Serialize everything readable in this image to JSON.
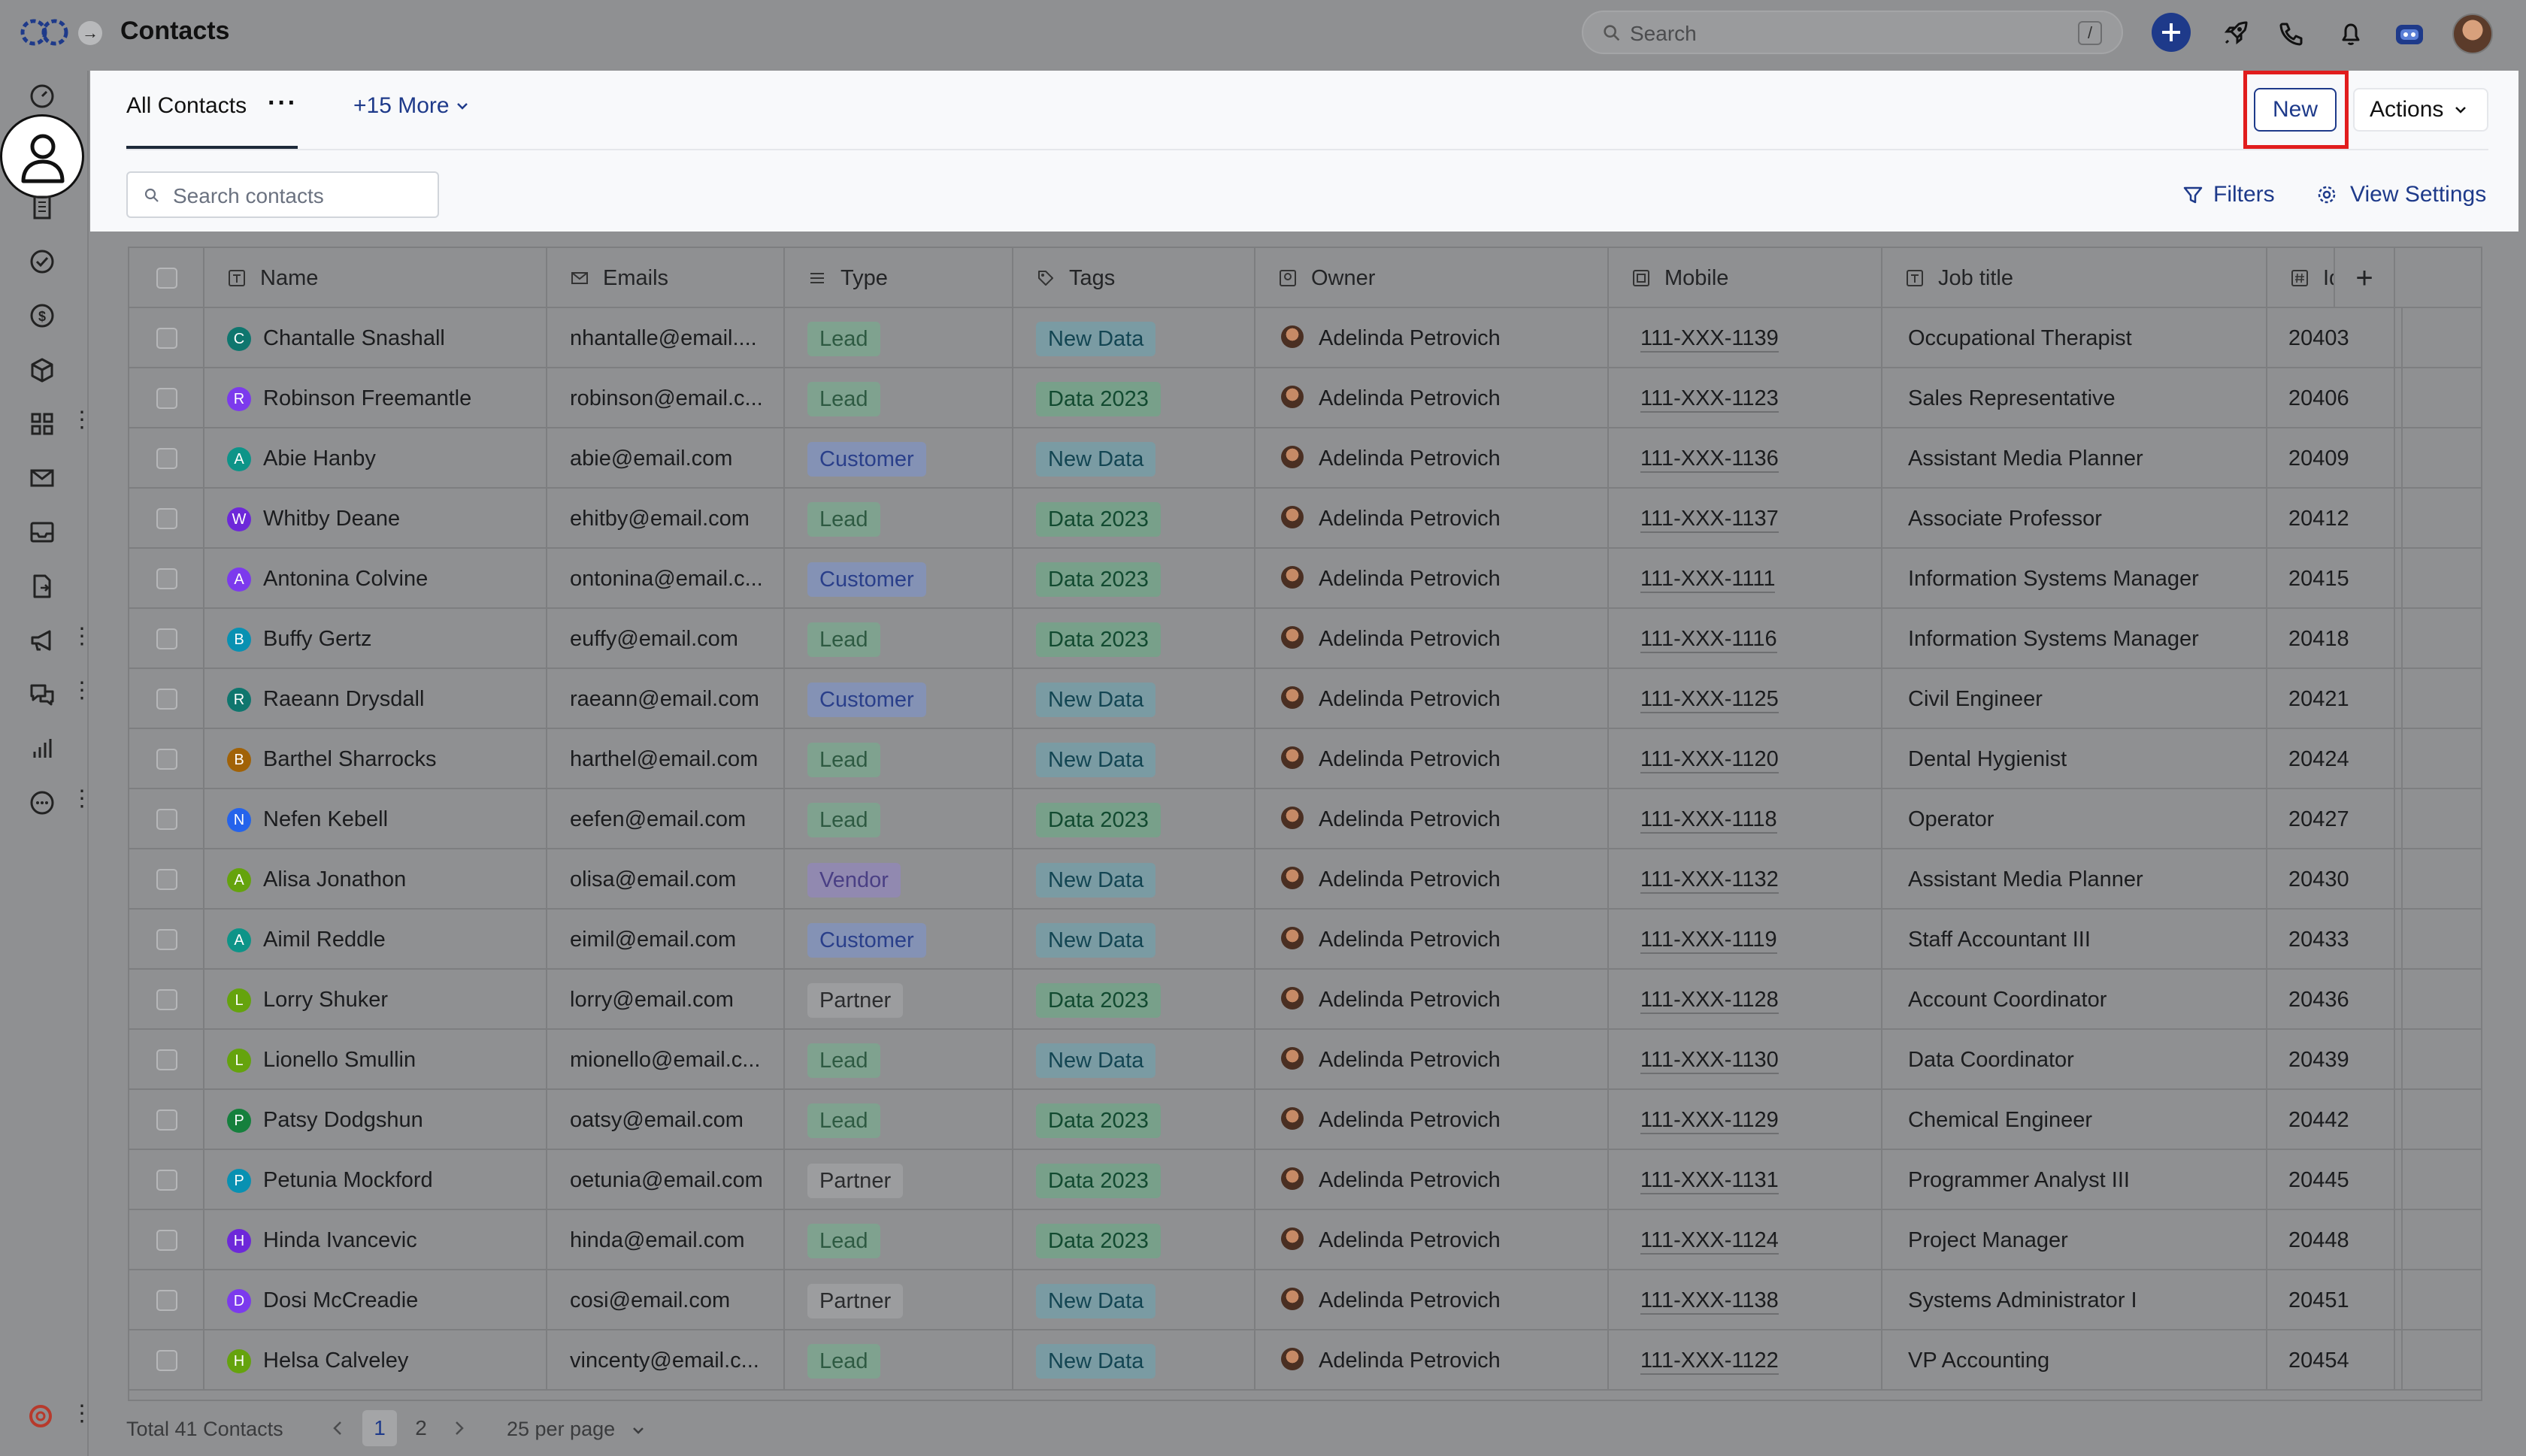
{
  "app": {
    "title": "Contacts"
  },
  "global_search": {
    "placeholder": "Search",
    "shortcut": "/"
  },
  "tabs": {
    "active": "All Contacts",
    "more": "+15 More"
  },
  "toolbar": {
    "new_label": "New",
    "actions_label": "Actions",
    "search_placeholder": "Search contacts",
    "filters_label": "Filters",
    "view_settings_label": "View Settings"
  },
  "table": {
    "columns": [
      "Name",
      "Emails",
      "Type",
      "Tags",
      "Owner",
      "Mobile",
      "Job title",
      "Id"
    ],
    "rows": [
      {
        "name": "Chantalle Snashall",
        "initial": "C",
        "avatar_color": "#0f766e",
        "email": "nhantalle@email....",
        "type": "Lead",
        "tag": "New Data",
        "owner": "Adelinda Petrovich",
        "mobile": "111-XXX-1139",
        "job": "Occupational Therapist",
        "id": "20403"
      },
      {
        "name": "Robinson Freemantle",
        "initial": "R",
        "avatar_color": "#7c3aed",
        "email": "robinson@email.c...",
        "type": "Lead",
        "tag": "Data 2023",
        "owner": "Adelinda Petrovich",
        "mobile": "111-XXX-1123",
        "job": "Sales Representative",
        "id": "20406"
      },
      {
        "name": "Abie Hanby",
        "initial": "A",
        "avatar_color": "#0d9488",
        "email": "abie@email.com",
        "type": "Customer",
        "tag": "New Data",
        "owner": "Adelinda Petrovich",
        "mobile": "111-XXX-1136",
        "job": "Assistant Media Planner",
        "id": "20409"
      },
      {
        "name": "Whitby Deane",
        "initial": "W",
        "avatar_color": "#6d28d9",
        "email": "ehitby@email.com",
        "type": "Lead",
        "tag": "Data 2023",
        "owner": "Adelinda Petrovich",
        "mobile": "111-XXX-1137",
        "job": "Associate Professor",
        "id": "20412"
      },
      {
        "name": "Antonina Colvine",
        "initial": "A",
        "avatar_color": "#7c3aed",
        "email": "ontonina@email.c...",
        "type": "Customer",
        "tag": "Data 2023",
        "owner": "Adelinda Petrovich",
        "mobile": "111-XXX-1111",
        "job": "Information Systems Manager",
        "id": "20415"
      },
      {
        "name": "Buffy Gertz",
        "initial": "B",
        "avatar_color": "#0891b2",
        "email": "euffy@email.com",
        "type": "Lead",
        "tag": "Data 2023",
        "owner": "Adelinda Petrovich",
        "mobile": "111-XXX-1116",
        "job": "Information Systems Manager",
        "id": "20418"
      },
      {
        "name": "Raeann Drysdall",
        "initial": "R",
        "avatar_color": "#0f766e",
        "email": "raeann@email.com",
        "type": "Customer",
        "tag": "New Data",
        "owner": "Adelinda Petrovich",
        "mobile": "111-XXX-1125",
        "job": "Civil Engineer",
        "id": "20421"
      },
      {
        "name": "Barthel Sharrocks",
        "initial": "B",
        "avatar_color": "#a16207",
        "email": "harthel@email.com",
        "type": "Lead",
        "tag": "New Data",
        "owner": "Adelinda Petrovich",
        "mobile": "111-XXX-1120",
        "job": "Dental Hygienist",
        "id": "20424"
      },
      {
        "name": "Nefen Kebell",
        "initial": "N",
        "avatar_color": "#2563eb",
        "email": "eefen@email.com",
        "type": "Lead",
        "tag": "Data 2023",
        "owner": "Adelinda Petrovich",
        "mobile": "111-XXX-1118",
        "job": "Operator",
        "id": "20427"
      },
      {
        "name": "Alisa Jonathon",
        "initial": "A",
        "avatar_color": "#65a30d",
        "email": "olisa@email.com",
        "type": "Vendor",
        "tag": "New Data",
        "owner": "Adelinda Petrovich",
        "mobile": "111-XXX-1132",
        "job": "Assistant Media Planner",
        "id": "20430"
      },
      {
        "name": "Aimil Reddle",
        "initial": "A",
        "avatar_color": "#0d9488",
        "email": "eimil@email.com",
        "type": "Customer",
        "tag": "New Data",
        "owner": "Adelinda Petrovich",
        "mobile": "111-XXX-1119",
        "job": "Staff Accountant III",
        "id": "20433"
      },
      {
        "name": "Lorry Shuker",
        "initial": "L",
        "avatar_color": "#65a30d",
        "email": "lorry@email.com",
        "type": "Partner",
        "tag": "Data 2023",
        "owner": "Adelinda Petrovich",
        "mobile": "111-XXX-1128",
        "job": "Account Coordinator",
        "id": "20436"
      },
      {
        "name": "Lionello Smullin",
        "initial": "L",
        "avatar_color": "#65a30d",
        "email": "mionello@email.c...",
        "type": "Lead",
        "tag": "New Data",
        "owner": "Adelinda Petrovich",
        "mobile": "111-XXX-1130",
        "job": "Data Coordinator",
        "id": "20439"
      },
      {
        "name": "Patsy Dodgshun",
        "initial": "P",
        "avatar_color": "#15803d",
        "email": "oatsy@email.com",
        "type": "Lead",
        "tag": "Data 2023",
        "owner": "Adelinda Petrovich",
        "mobile": "111-XXX-1129",
        "job": "Chemical Engineer",
        "id": "20442"
      },
      {
        "name": "Petunia Mockford",
        "initial": "P",
        "avatar_color": "#0891b2",
        "email": "oetunia@email.com",
        "type": "Partner",
        "tag": "Data 2023",
        "owner": "Adelinda Petrovich",
        "mobile": "111-XXX-1131",
        "job": "Programmer Analyst III",
        "id": "20445"
      },
      {
        "name": "Hinda Ivancevic",
        "initial": "H",
        "avatar_color": "#6d28d9",
        "email": "hinda@email.com",
        "type": "Lead",
        "tag": "Data 2023",
        "owner": "Adelinda Petrovich",
        "mobile": "111-XXX-1124",
        "job": "Project Manager",
        "id": "20448"
      },
      {
        "name": "Dosi McCreadie",
        "initial": "D",
        "avatar_color": "#7c3aed",
        "email": "cosi@email.com",
        "type": "Partner",
        "tag": "New Data",
        "owner": "Adelinda Petrovich",
        "mobile": "111-XXX-1138",
        "job": "Systems Administrator I",
        "id": "20451"
      },
      {
        "name": "Helsa Calveley",
        "initial": "H",
        "avatar_color": "#65a30d",
        "email": "vincenty@email.c...",
        "type": "Lead",
        "tag": "New Data",
        "owner": "Adelinda Petrovich",
        "mobile": "111-XXX-1122",
        "job": "VP Accounting",
        "id": "20454"
      }
    ]
  },
  "type_styles": {
    "Lead": {
      "bg": "#7fa28f",
      "fg": "#2e5a42"
    },
    "Customer": {
      "bg": "#8492b5",
      "fg": "#2a3f8a"
    },
    "Vendor": {
      "bg": "#9189b0",
      "fg": "#4a3f84"
    },
    "Partner": {
      "bg": "#9c9d9f",
      "fg": "#2b2c2e"
    }
  },
  "tag_styles": {
    "New Data": {
      "bg": "#7a9ba3",
      "fg": "#134552"
    },
    "Data 2023": {
      "bg": "#78a08a",
      "fg": "#124a30"
    }
  },
  "footer": {
    "total": "Total 41 Contacts",
    "pages": [
      "1",
      "2"
    ],
    "per_page": "25 per page"
  }
}
